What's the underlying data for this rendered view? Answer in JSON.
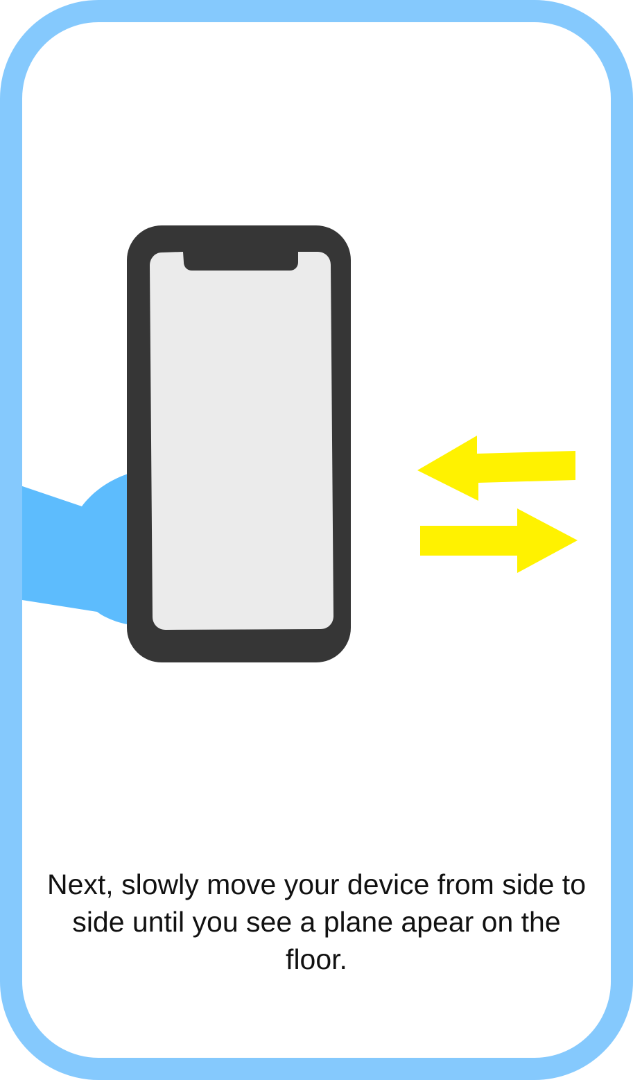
{
  "onboarding": {
    "instruction_text": "Next, slowly move your device from side to side until you see a plane apear on the floor.",
    "illustration": {
      "device_icon": "phone-icon",
      "hand_icon": "hand-icon",
      "motion_icon": "left-right-arrows-icon"
    }
  },
  "colors": {
    "frame_border": "#85c9fd",
    "phone_body": "#363636",
    "phone_screen": "#ebebeb",
    "hand": "#5dbcfd",
    "arrows": "#fff200",
    "text": "#111111"
  }
}
